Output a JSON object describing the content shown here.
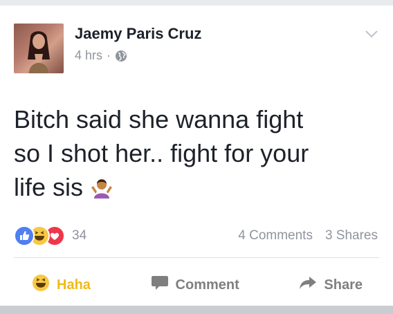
{
  "post": {
    "author": "Jaemy Paris Cruz",
    "time": "4 hrs",
    "separator": "·",
    "text_lines": [
      "Bitch said she wanna fight",
      "so I shot her.. fight for your",
      "life sis"
    ],
    "reaction_count": "34",
    "comments": "4 Comments",
    "shares": "3 Shares"
  },
  "actions": {
    "haha": "Haha",
    "comment": "Comment",
    "share": "Share"
  },
  "icons": {
    "reactions": [
      "like-icon",
      "haha-icon",
      "love-icon"
    ],
    "globe": "globe-icon",
    "chevron": "chevron-down-icon",
    "emoji": "person-shrugging-emoji"
  },
  "colors": {
    "like": "#4f7ff0",
    "haha": "#f7c844",
    "love": "#f0364a",
    "text": "#1d2129",
    "muted": "#90949c"
  }
}
